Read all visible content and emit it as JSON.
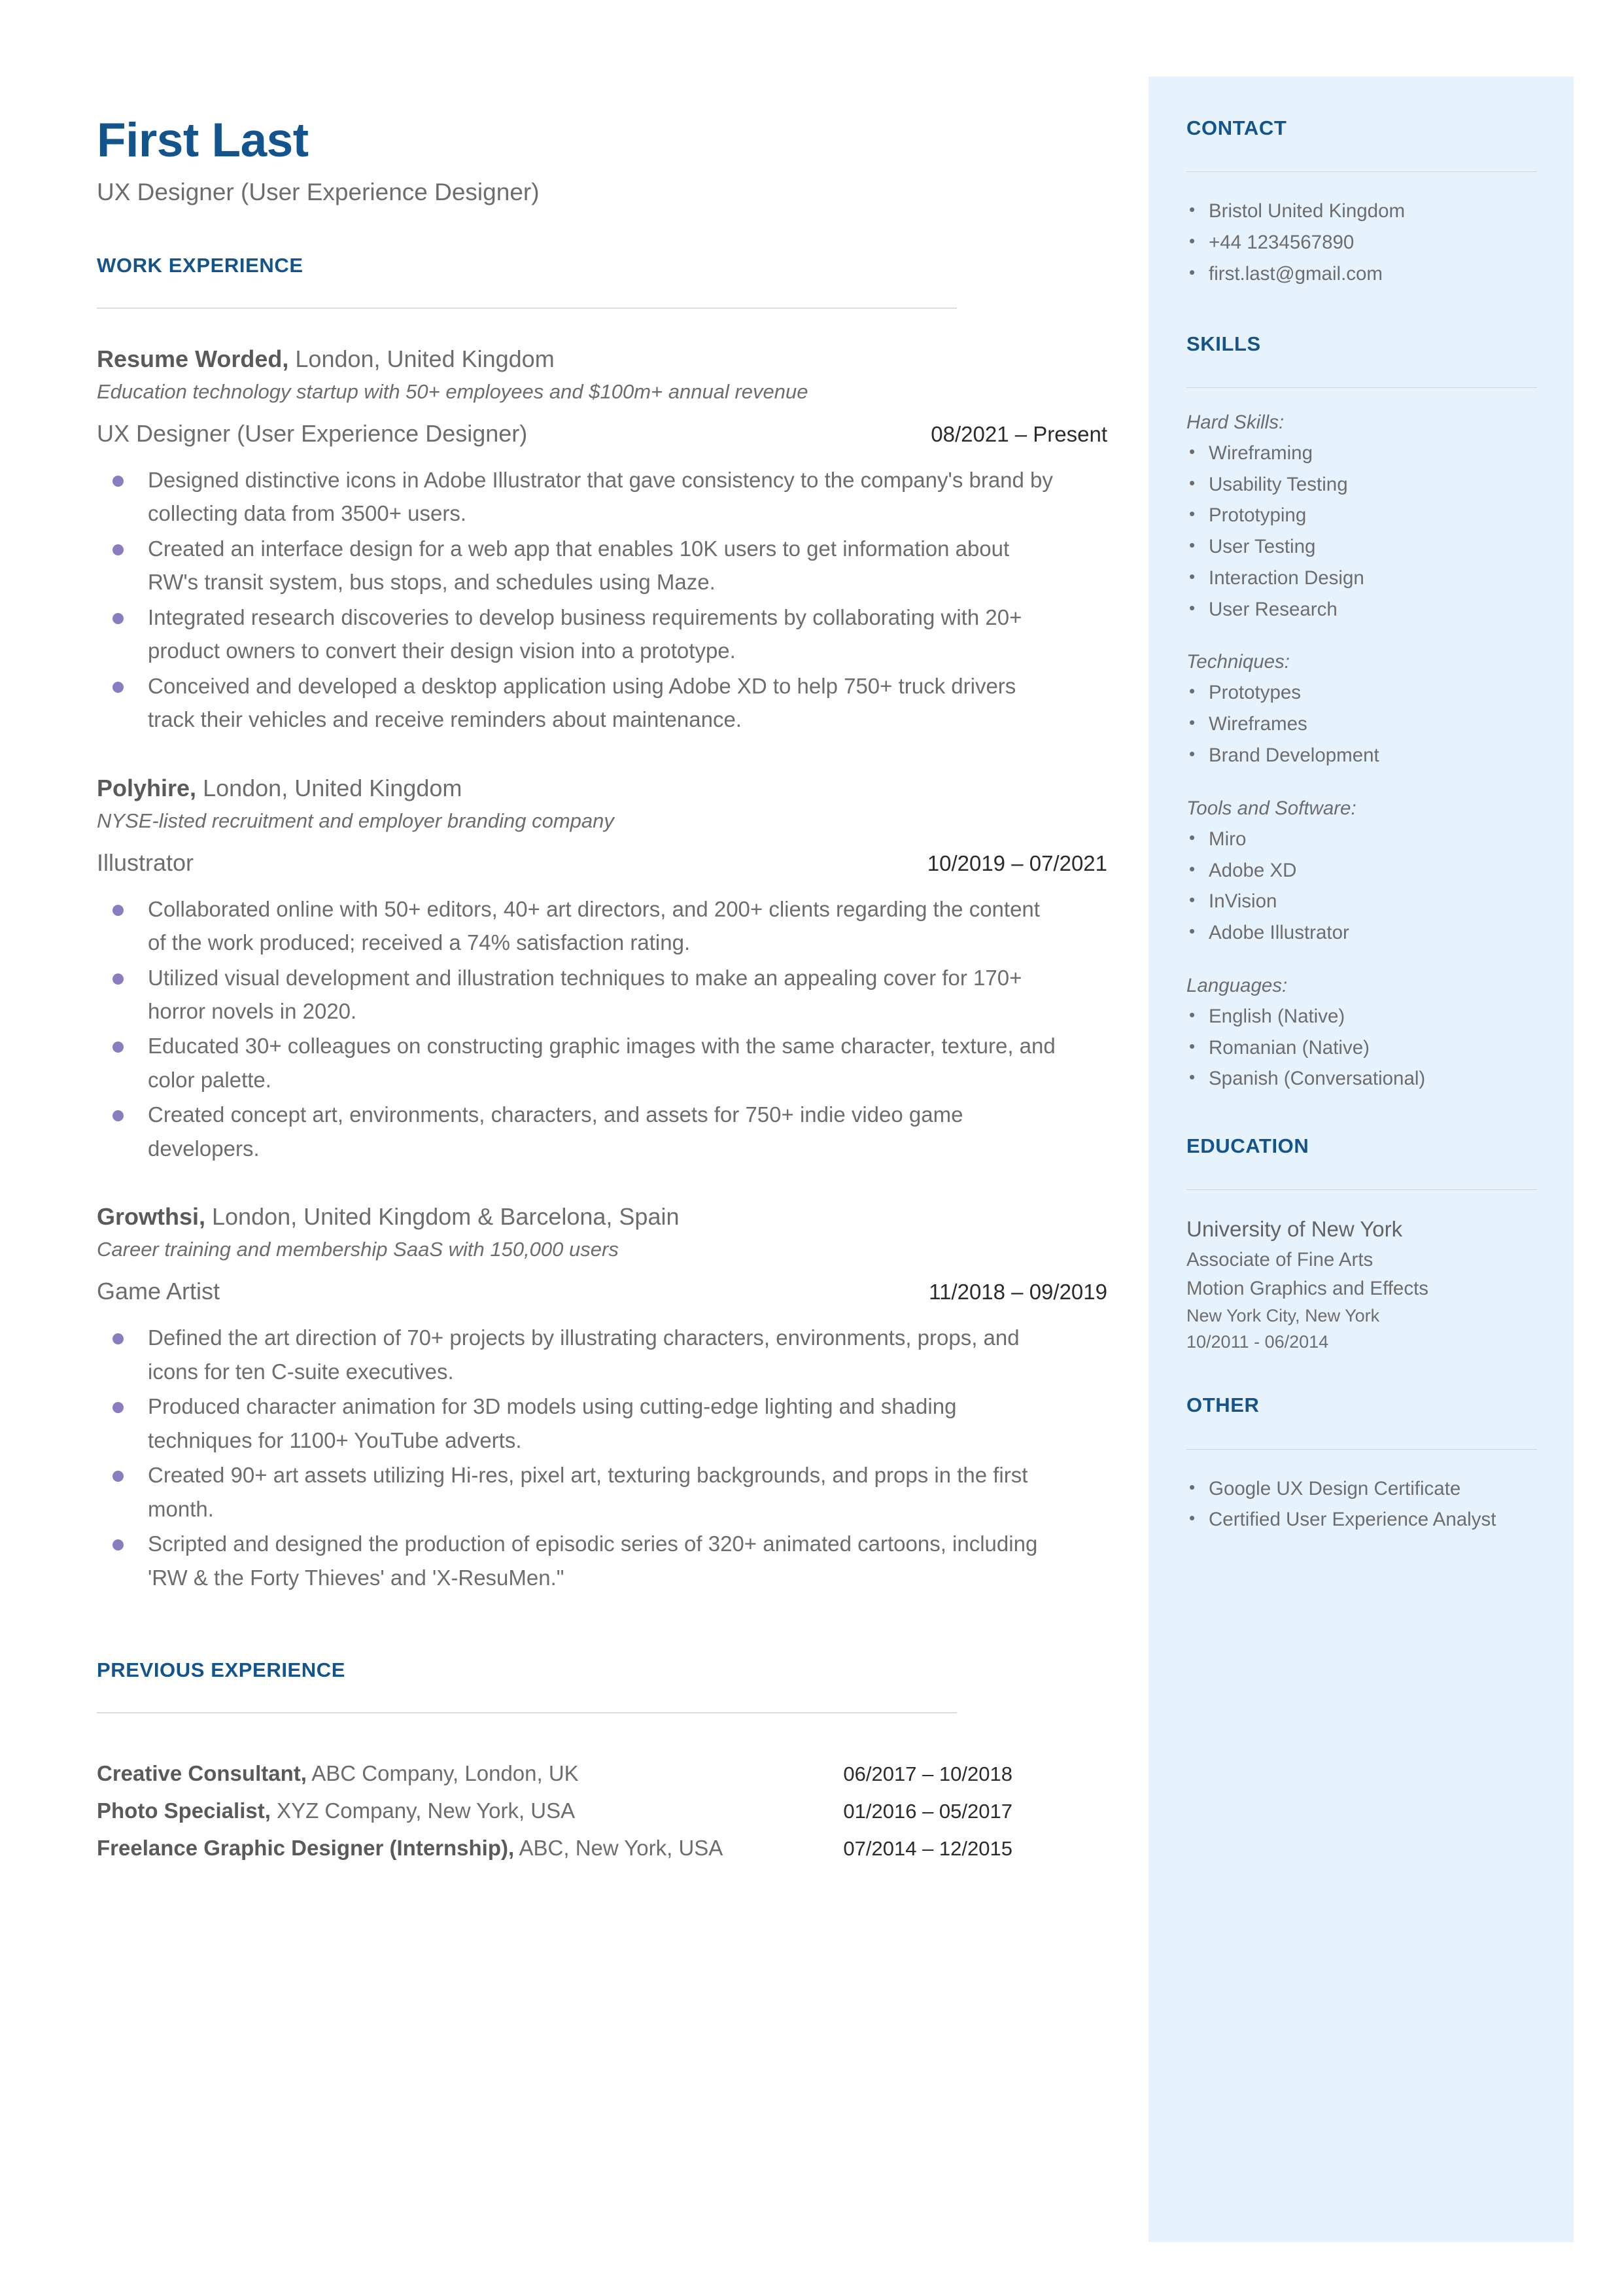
{
  "header": {
    "name": "First Last",
    "subtitle": "UX Designer (User Experience Designer)"
  },
  "main": {
    "work_experience_heading": "WORK EXPERIENCE",
    "previous_experience_heading": "PREVIOUS EXPERIENCE",
    "jobs": [
      {
        "company": "Resume Worded,",
        "location": " London, United Kingdom",
        "description": "Education technology startup with 50+ employees and $100m+ annual revenue",
        "title": "UX Designer (User Experience Designer)",
        "dates": "08/2021 – Present",
        "bullets": [
          "Designed distinctive icons in Adobe Illustrator that gave consistency to the company's brand by collecting data from 3500+ users.",
          "Created an interface design for a web app that enables 10K users to get information about RW's transit system, bus stops, and schedules using Maze.",
          "Integrated research discoveries to develop business requirements by collaborating with 20+ product owners to convert their design vision into a prototype.",
          "Conceived and developed a desktop application using Adobe XD to help 750+ truck drivers track their vehicles and receive reminders about maintenance."
        ]
      },
      {
        "company": "Polyhire,",
        "location": " London, United Kingdom",
        "description": "NYSE-listed recruitment and employer branding company",
        "title": "Illustrator",
        "dates": "10/2019 – 07/2021",
        "bullets": [
          "Collaborated online with 50+ editors, 40+ art directors, and 200+ clients regarding the content of the work produced; received a 74% satisfaction rating.",
          "Utilized visual development and illustration techniques to make an appealing cover for 170+ horror novels in 2020.",
          "Educated 30+ colleagues on constructing graphic images with the same character, texture, and color palette.",
          "Created concept art, environments, characters, and assets for 750+ indie video game developers."
        ]
      },
      {
        "company": "Growthsi,",
        "location": " London, United Kingdom & Barcelona, Spain",
        "description": "Career training and membership SaaS with 150,000 users",
        "title": "Game Artist",
        "dates": "11/2018 – 09/2019",
        "bullets": [
          "Defined the art direction of 70+ projects by illustrating characters, environments, props, and icons for ten C-suite executives.",
          "Produced character animation for 3D models using cutting-edge lighting and shading techniques for 1100+ YouTube adverts.",
          "Created 90+ art assets utilizing Hi-res, pixel art, texturing backgrounds, and props in the first month.",
          "Scripted and designed the production of episodic series of 320+ animated cartoons, including 'RW & the Forty Thieves' and 'X-ResuMen.\""
        ]
      }
    ],
    "previous_experience": [
      {
        "role": "Creative Consultant,",
        "detail": " ABC Company, London, UK",
        "dates": "06/2017 – 10/2018"
      },
      {
        "role": "Photo Specialist,",
        "detail": " XYZ Company, New York, USA",
        "dates": "01/2016 – 05/2017"
      },
      {
        "role": "Freelance Graphic Designer (Internship),",
        "detail": " ABC, New York, USA",
        "dates": "07/2014 – 12/2015"
      }
    ]
  },
  "sidebar": {
    "contact": {
      "heading": "CONTACT",
      "items": [
        "Bristol United Kingdom",
        "+44 1234567890",
        "first.last@gmail.com"
      ]
    },
    "skills": {
      "heading": "SKILLS",
      "groups": [
        {
          "label": "Hard Skills:",
          "items": [
            "Wireframing",
            "Usability Testing",
            "Prototyping",
            "User Testing",
            "Interaction Design",
            "User Research"
          ]
        },
        {
          "label": "Techniques:",
          "items": [
            "Prototypes",
            "Wireframes",
            "Brand Development"
          ]
        },
        {
          "label": "Tools and Software:",
          "items": [
            "Miro",
            "Adobe XD",
            "InVision",
            "Adobe Illustrator"
          ]
        },
        {
          "label": "Languages:",
          "items": [
            "English (Native)",
            "Romanian (Native)",
            "Spanish (Conversational)"
          ]
        }
      ]
    },
    "education": {
      "heading": "EDUCATION",
      "school": "University of New York",
      "degree": "Associate of Fine Arts",
      "field": "Motion Graphics and Effects",
      "location": "New York City, New York",
      "dates": "10/2011 - 06/2014"
    },
    "other": {
      "heading": "OTHER",
      "items": [
        "Google UX Design Certificate",
        "Certified User Experience Analyst"
      ]
    }
  },
  "colors": {
    "accent_blue": "#14548c",
    "sidebar_bg": "#e6f3fd",
    "bullet_purple": "#8a7cc0",
    "body_text": "#6d6d6d"
  }
}
